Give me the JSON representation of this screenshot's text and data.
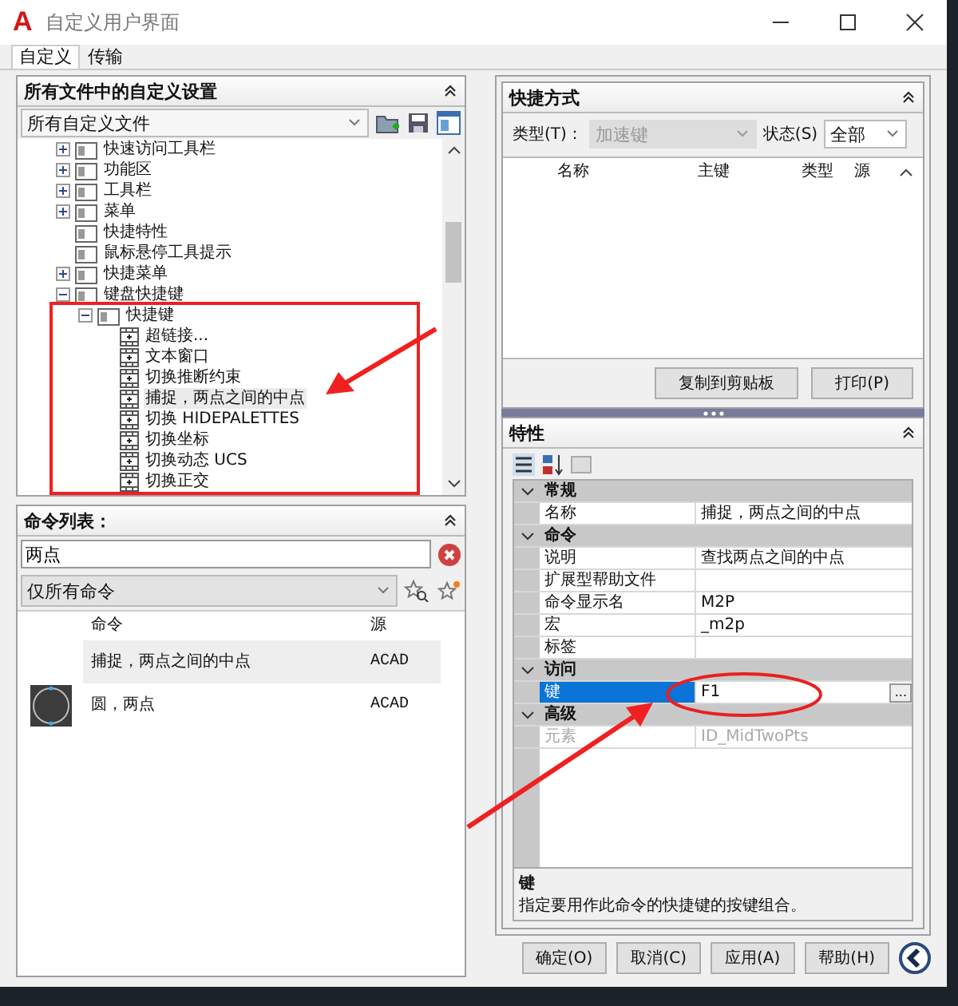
{
  "window": {
    "logo": "A",
    "title": "自定义用户界面"
  },
  "tabs": [
    {
      "label": "自定义",
      "selected": true
    },
    {
      "label": "传输",
      "selected": false
    }
  ],
  "customizations_panel": {
    "title": "所有文件中的自定义设置",
    "file_select": "所有自定义文件",
    "tree": [
      {
        "label": "快速访问工具栏",
        "kind": "branch",
        "expanded": false,
        "selected": false
      },
      {
        "label": "功能区",
        "kind": "branch",
        "expanded": false,
        "selected": false
      },
      {
        "label": "工具栏",
        "kind": "branch",
        "expanded": false,
        "selected": false
      },
      {
        "label": "菜单",
        "kind": "branch",
        "expanded": false,
        "selected": false
      },
      {
        "label": "快捷特性",
        "kind": "leaf",
        "selected": false
      },
      {
        "label": "鼠标悬停工具提示",
        "kind": "leaf",
        "selected": false
      },
      {
        "label": "快捷菜单",
        "kind": "branch",
        "expanded": false,
        "selected": false
      },
      {
        "label": "键盘快捷键",
        "kind": "branch",
        "expanded": true,
        "selected": false,
        "children": [
          {
            "label": "快捷键",
            "kind": "branch",
            "expanded": true,
            "selected": false,
            "children": [
              {
                "label": "超链接...",
                "kind": "leaf",
                "selected": false
              },
              {
                "label": "文本窗口",
                "kind": "leaf",
                "selected": false
              },
              {
                "label": "切换推断约束",
                "kind": "leaf",
                "selected": false
              },
              {
                "label": "捕捉，两点之间的中点",
                "kind": "leaf",
                "selected": true
              },
              {
                "label": "切换 HIDEPALETTES",
                "kind": "leaf",
                "selected": false
              },
              {
                "label": "切换坐标",
                "kind": "leaf",
                "selected": false
              },
              {
                "label": "切换动态 UCS",
                "kind": "leaf",
                "selected": false
              },
              {
                "label": "切换正交",
                "kind": "leaf",
                "selected": false
              }
            ]
          }
        ]
      }
    ]
  },
  "command_list": {
    "title": "命令列表：",
    "search": "两点",
    "filter": "仅所有命令",
    "columns": [
      "命令",
      "源"
    ],
    "rows": [
      {
        "kind": "plain",
        "command": "捕捉，两点之间的中点",
        "source": "ACAD",
        "selected": true
      },
      {
        "kind": "thumbnail",
        "command": "圆，两点",
        "source": "ACAD",
        "selected": false
      }
    ]
  },
  "shortcuts_panel": {
    "title": "快捷方式",
    "type_label": "类型(T)：",
    "type_value": "加速键",
    "type_disabled": true,
    "status_label": "状态(S)",
    "status_value": "全部",
    "columns": [
      "名称",
      "主键",
      "类型",
      "源"
    ],
    "buttons": [
      "复制到剪贴板",
      "打印(P)"
    ]
  },
  "properties_panel": {
    "title": "特性",
    "categories": [
      {
        "name": "常规",
        "expanded": true,
        "rows": [
          {
            "label": "名称",
            "value": "捕捉，两点之间的中点",
            "selected": false,
            "disabled": false
          }
        ]
      },
      {
        "name": "命令",
        "expanded": true,
        "rows": [
          {
            "label": "说明",
            "value": "查找两点之间的中点",
            "selected": false,
            "disabled": false
          },
          {
            "label": "扩展型帮助文件",
            "selected": false,
            "disabled": false
          },
          {
            "label": "命令显示名",
            "value": "M2P",
            "selected": false,
            "disabled": false
          },
          {
            "label": "宏",
            "value": "_m2p",
            "selected": false,
            "disabled": false
          },
          {
            "label": "标签",
            "selected": false,
            "disabled": false
          }
        ]
      },
      {
        "name": "访问",
        "expanded": true,
        "rows": [
          {
            "label": "键",
            "value": "F1",
            "button": "...",
            "selected": true,
            "disabled": false
          }
        ]
      },
      {
        "name": "高级",
        "expanded": true,
        "rows": [
          {
            "label": "元素",
            "value": "ID_MidTwoPts",
            "selected": false,
            "disabled": true
          }
        ]
      }
    ],
    "description": {
      "title": "键",
      "text": "指定要用作此命令的快捷键的按键组合。"
    }
  },
  "footer_buttons": [
    "确定(O)",
    "取消(C)",
    "应用(A)",
    "帮助(H)"
  ]
}
